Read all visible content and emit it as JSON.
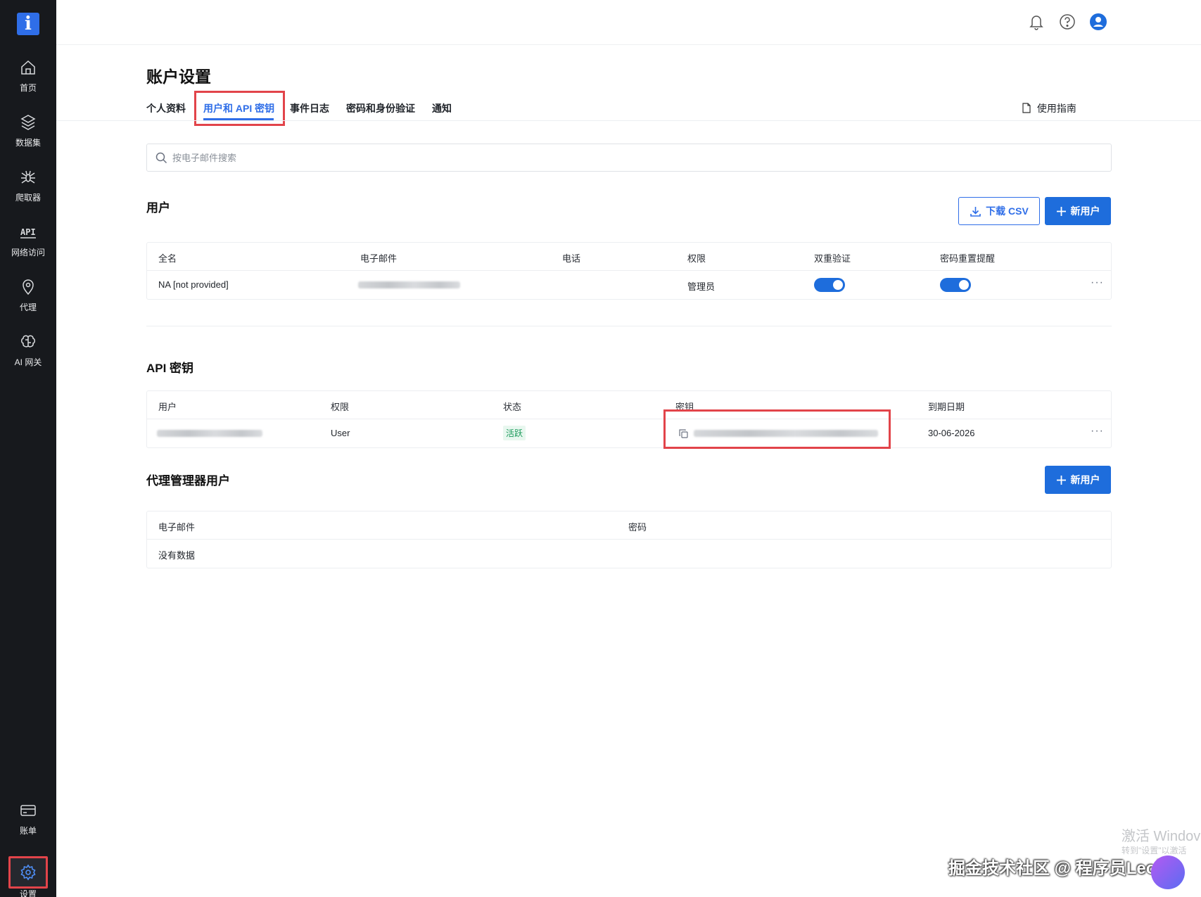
{
  "sidebar": {
    "logo": "i",
    "items": [
      {
        "label": "首页"
      },
      {
        "label": "数据集"
      },
      {
        "label": "爬取器"
      },
      {
        "label": "网络访问"
      },
      {
        "label": "代理"
      },
      {
        "label": "AI 网关"
      },
      {
        "label": "账单"
      },
      {
        "label": "设置"
      }
    ]
  },
  "page": {
    "title": "账户设置"
  },
  "tabs": [
    {
      "label": "个人资料"
    },
    {
      "label": "用户和 API 密钥",
      "active": true
    },
    {
      "label": "事件日志"
    },
    {
      "label": "密码和身份验证"
    },
    {
      "label": "通知"
    }
  ],
  "guide_label": "使用指南",
  "search": {
    "placeholder": "按电子邮件搜索"
  },
  "users": {
    "title": "用户",
    "download_label": "下载 CSV",
    "new_user_label": "新用户",
    "columns": [
      "全名",
      "电子邮件",
      "电话",
      "权限",
      "双重验证",
      "密码重置提醒"
    ],
    "rows": [
      {
        "full_name": "NA [not provided]",
        "permission": "管理员",
        "two_factor": true,
        "password_reminder": true
      }
    ]
  },
  "api_keys": {
    "title": "API 密钥",
    "columns": [
      "用户",
      "权限",
      "状态",
      "密钥",
      "到期日期"
    ],
    "rows": [
      {
        "permission": "User",
        "status": "活跃",
        "expires": "30-06-2026"
      }
    ]
  },
  "proxy_users": {
    "title": "代理管理器用户",
    "new_user_label": "新用户",
    "columns": [
      "电子邮件",
      "密码"
    ],
    "empty_text": "没有数据"
  },
  "overlay": {
    "activate_title": "激活 Windov",
    "activate_sub": "转到\"设置\"以激活",
    "credit": "掘金技术社区 @ 程序员Leo说"
  },
  "colors": {
    "accent": "#1e6ddc",
    "sidebar_bg": "#17191d",
    "highlight": "#e2444a",
    "active_status": "#1a9a5a"
  }
}
